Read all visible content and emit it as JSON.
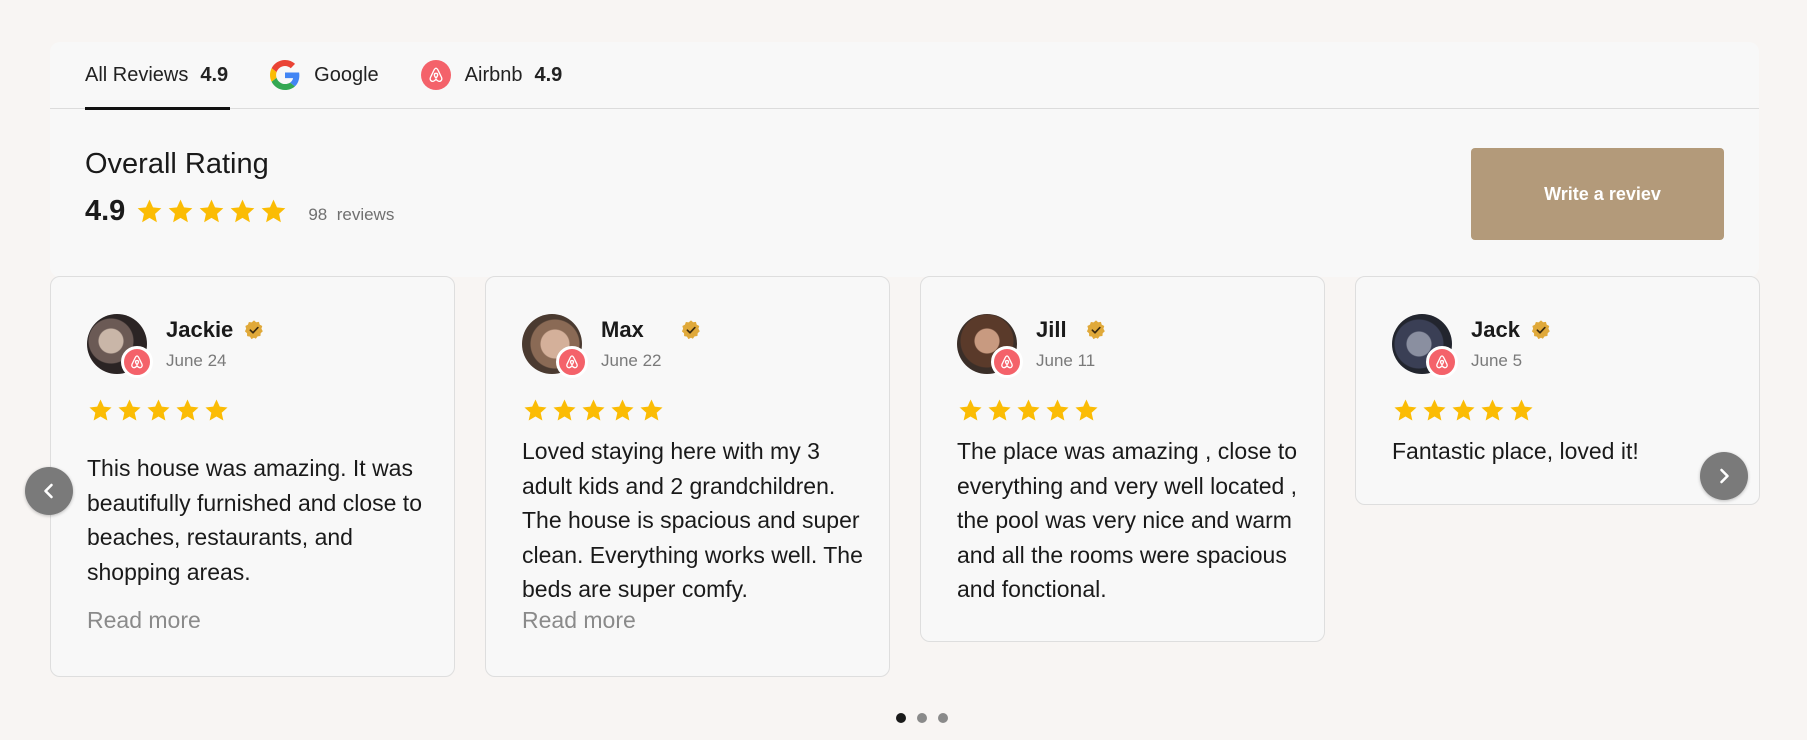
{
  "tabs": [
    {
      "label": "All Reviews",
      "score": "4.9",
      "icon": null,
      "active": true
    },
    {
      "label": "Google",
      "score": "",
      "icon": "google-icon",
      "active": false
    },
    {
      "label": "Airbnb",
      "score": "4.9",
      "icon": "airbnb-icon",
      "active": false
    }
  ],
  "overall": {
    "title": "Overall Rating",
    "score": "4.9",
    "stars": 5,
    "count": "98",
    "count_label": "reviews"
  },
  "write_button": "Write a reviev",
  "read_more_label": "Read more",
  "reviews": [
    {
      "name": "Jackie",
      "date": "June 24",
      "stars": 5,
      "text": "This house was amazing. It was beautifully furnished and close to beaches, restaurants, and shopping areas.",
      "read_more": true
    },
    {
      "name": "Max",
      "date": "June 22",
      "stars": 5,
      "text": "Loved staying here with my 3 adult kids and 2 grandchildren. The house is spacious and super clean. Everything works well. The beds are super comfy.",
      "read_more": true
    },
    {
      "name": "Jill",
      "date": "June 11",
      "stars": 5,
      "text": "The place was amazing , close to everything and very well located , the pool was very nice and warm and all the rooms were spacious and fonctional.",
      "read_more": false
    },
    {
      "name": "Jack",
      "date": "June 5",
      "stars": 5,
      "text": "Fantastic place, loved it!",
      "read_more": false
    }
  ],
  "pagination": {
    "pages": 3,
    "current": 1
  },
  "colors": {
    "star": "#fbbc04",
    "airbnb": "#f4626a",
    "button": "#b39a7a",
    "verified": "#e0a93a"
  }
}
